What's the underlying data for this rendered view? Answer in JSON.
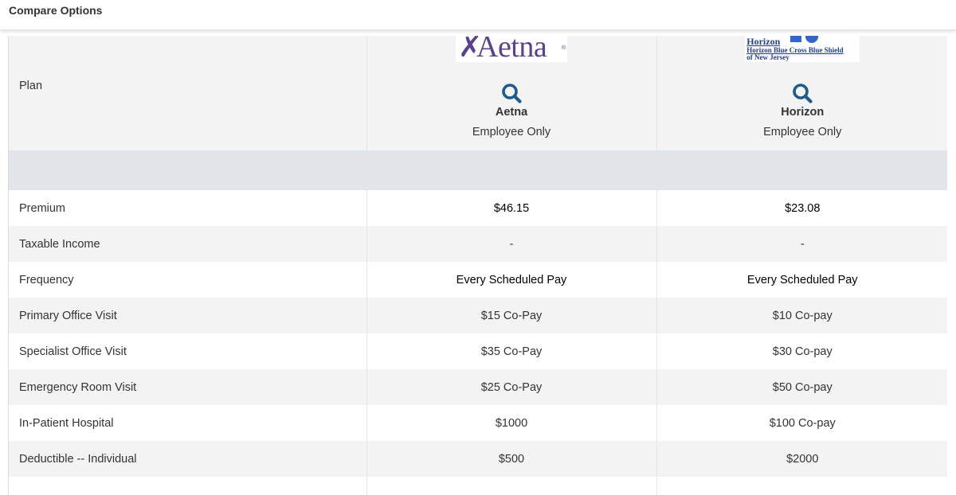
{
  "header": {
    "title": "Compare Options"
  },
  "plan_row": {
    "label": "Plan"
  },
  "plans": [
    {
      "name": "Aetna",
      "coverage": "Employee Only",
      "logo": {
        "text": "Aetna",
        "color": "#5b3f90"
      },
      "search_icon": "search-icon"
    },
    {
      "name": "Horizon",
      "coverage": "Employee Only",
      "logo": {
        "text": "Horizon",
        "line": "Horizon Blue Cross Blue Shield",
        "line2": "of New Jersey",
        "color": "#1d3f8f"
      },
      "search_icon": "search-icon"
    }
  ],
  "rows": [
    {
      "label": "Premium",
      "values": [
        "$46.15",
        "$23.08"
      ]
    },
    {
      "label": "Taxable Income",
      "values": [
        "-",
        "-"
      ]
    },
    {
      "label": "Frequency",
      "values": [
        "Every Scheduled Pay",
        "Every Scheduled Pay"
      ]
    },
    {
      "label": "Primary Office Visit",
      "values": [
        "$15 Co-Pay",
        "$10 Co-pay"
      ]
    },
    {
      "label": "Specialist Office Visit",
      "values": [
        "$35 Co-Pay",
        "$30 Co-pay"
      ]
    },
    {
      "label": "Emergency Room Visit",
      "values": [
        "$25 Co-Pay",
        "$50 Co-pay"
      ]
    },
    {
      "label": "In-Patient Hospital",
      "values": [
        "$1000",
        "$100 Co-pay"
      ]
    },
    {
      "label": "Deductible -- Individual",
      "values": [
        "$500",
        "$2000"
      ]
    }
  ],
  "colors": {
    "icon_accent": "#1e5a8c",
    "row_alt": "#f3f3f3",
    "section_band": "#e1e4e8"
  }
}
